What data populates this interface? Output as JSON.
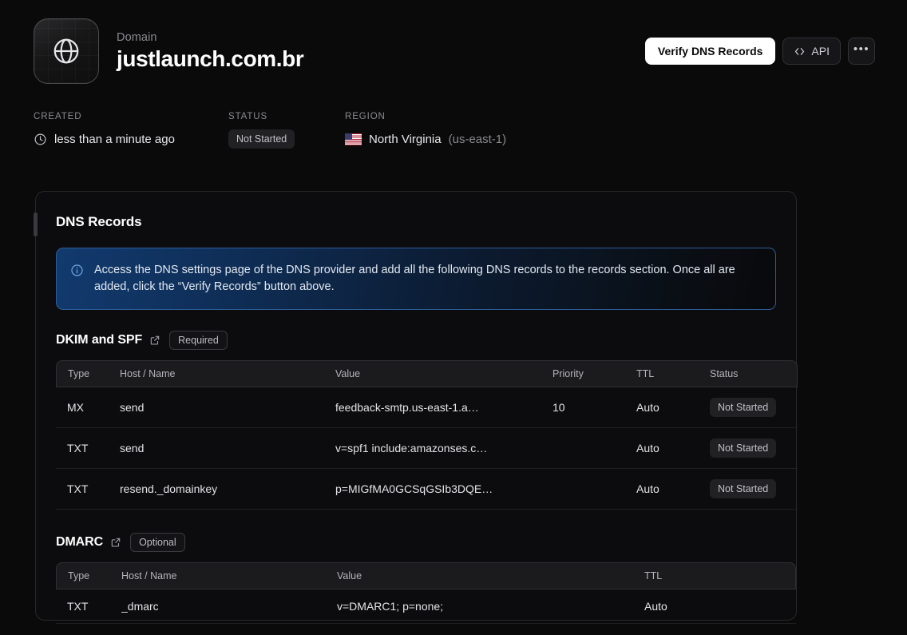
{
  "header": {
    "avatar_icon": "globe-icon",
    "eyebrow": "Domain",
    "title": "justlaunch.com.br",
    "verify_button": "Verify DNS Records",
    "api_button": "API",
    "more_button": "•••"
  },
  "meta": {
    "created_label": "CREATED",
    "created_value": "less than a minute ago",
    "status_label": "STATUS",
    "status_value": "Not Started",
    "region_label": "REGION",
    "region_name": "North Virginia",
    "region_code": "(us-east-1)"
  },
  "card": {
    "title": "DNS Records",
    "banner_text": "Access the DNS settings page of the DNS provider and add all the following DNS records to the records section. Once all are added, click the “Verify Records” button above."
  },
  "dkim": {
    "name": "DKIM and SPF",
    "badge": "Required",
    "columns": [
      "Type",
      "Host / Name",
      "Value",
      "Priority",
      "TTL",
      "Status"
    ],
    "rows": [
      {
        "type": "MX",
        "host": "send",
        "value": "feedback-smtp.us-east-1.a…",
        "priority": "10",
        "ttl": "Auto",
        "status": "Not Started"
      },
      {
        "type": "TXT",
        "host": "send",
        "value": "v=spf1 include:amazonses.c…",
        "priority": "",
        "ttl": "Auto",
        "status": "Not Started"
      },
      {
        "type": "TXT",
        "host": "resend._domainkey",
        "value": "p=MIGfMA0GCSqGSIb3DQE…",
        "priority": "",
        "ttl": "Auto",
        "status": "Not Started"
      }
    ]
  },
  "dmarc": {
    "name": "DMARC",
    "badge": "Optional",
    "columns": [
      "Type",
      "Host / Name",
      "Value",
      "TTL"
    ],
    "rows": [
      {
        "type": "TXT",
        "host": "_dmarc",
        "value": "v=DMARC1; p=none;",
        "ttl": "Auto"
      }
    ]
  },
  "colors": {
    "page_bg": "#0a0a0b",
    "card_bg": "#0c0c0e",
    "accent_blue": "#2d5c96",
    "primary_button": "#ffffff"
  }
}
